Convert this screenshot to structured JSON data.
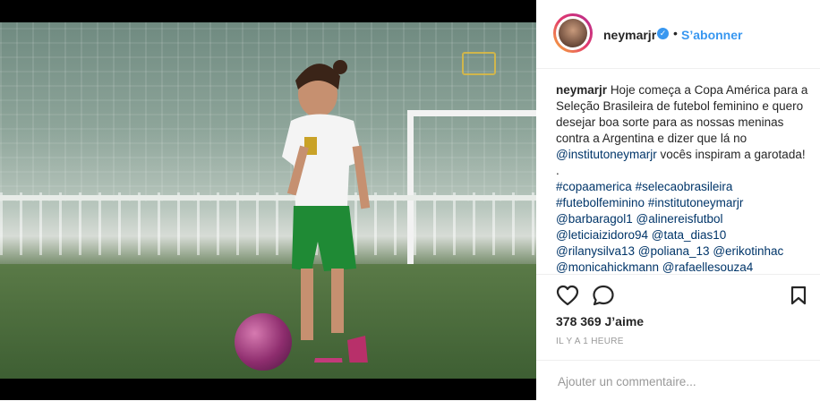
{
  "post": {
    "username": "neymarjr",
    "follow_label": "S’abonner",
    "separator": "•",
    "verified_mark": "✓",
    "caption": {
      "author": "neymarjr",
      "text_line1": "Hoje começa a Copa América para a Seleção Brasileira de futebol feminino e quero desejar boa sorte para as nossas meninas contra a Argentina e dizer que lá no ",
      "mention_inline": "@institutoneymarjr",
      "text_line2": " vocês inspiram a garotada! .",
      "hashtags": [
        "#copaamerica",
        "#selecaobrasileira",
        "#futebolfeminino",
        "#institutoneymarjr"
      ],
      "mentions": [
        "@barbaragol1",
        "@alinereisfutbol",
        "@leticiaizidoro94",
        "@tata_dias10",
        "@rilanysilva13",
        "@poliana_13",
        "@erikotinhac",
        "@monicahickmann",
        "@rafaellesouza4"
      ]
    },
    "likes": "378 369 J’aime",
    "timestamp": "Il y a 1 heure",
    "comment_placeholder": "Ajouter un commentaire...",
    "icons": {
      "like": "heart-icon",
      "comment": "comment-icon",
      "save": "bookmark-icon",
      "verified": "verified-badge-icon"
    },
    "colors": {
      "link": "#3897f0",
      "tag": "#003569",
      "text": "#262626",
      "muted": "#999999",
      "border": "#efefef"
    }
  }
}
